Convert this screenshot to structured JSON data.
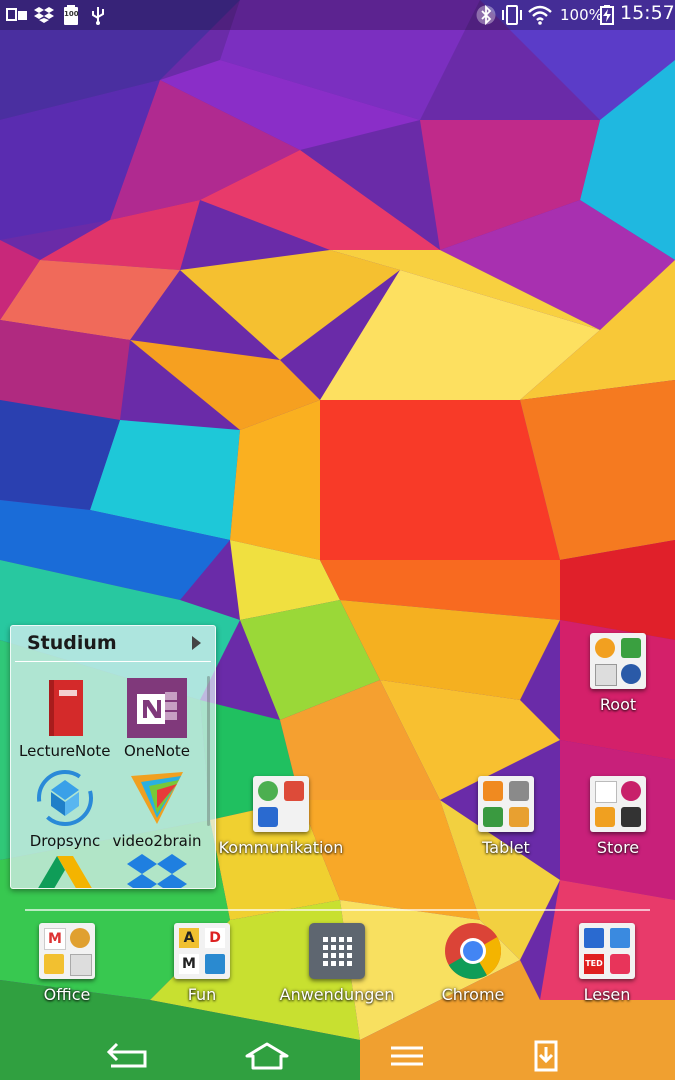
{
  "status_bar": {
    "left_icons": [
      "screen-mirror-icon",
      "dropbox-icon",
      "battery-100-icon",
      "usb-icon"
    ],
    "battery_small_label": "100",
    "right_icons": [
      "bluetooth-icon",
      "vibrate-icon",
      "wifi-icon",
      "battery-charging-icon"
    ],
    "battery_percent": "100%",
    "time": "15:57"
  },
  "folder": {
    "title": "Studium",
    "apps": [
      {
        "label": "LectureNotes",
        "icon": "lecturenotes-icon"
      },
      {
        "label": "OneNote",
        "icon": "onenote-icon"
      },
      {
        "label": "Dropsync",
        "icon": "dropsync-icon"
      },
      {
        "label": "video2brain",
        "icon": "video2brain-icon"
      },
      {
        "label": "",
        "icon": "google-drive-icon"
      },
      {
        "label": "",
        "icon": "dropbox-app-icon"
      }
    ]
  },
  "home_apps": [
    {
      "label": "Root",
      "icon": "root-folder-icon"
    },
    {
      "label": "Kommunikation",
      "icon": "kommunikation-folder-icon"
    },
    {
      "label": "Tablet",
      "icon": "tablet-folder-icon"
    },
    {
      "label": "Store",
      "icon": "store-folder-icon"
    }
  ],
  "dock": [
    {
      "label": "Office",
      "icon": "office-folder-icon"
    },
    {
      "label": "Fun",
      "icon": "fun-folder-icon"
    },
    {
      "label": "Anwendungen",
      "icon": "app-drawer-icon"
    },
    {
      "label": "Chrome",
      "icon": "chrome-icon"
    },
    {
      "label": "Lesen",
      "icon": "lesen-folder-icon"
    }
  ],
  "nav": [
    "back-icon",
    "home-icon",
    "menu-icon",
    "download-tray-icon"
  ],
  "colors": {
    "onenote": "#80397b",
    "lecturenotes": "#d42a2a",
    "chrome_red": "#db4437",
    "chrome_green": "#0f9d58",
    "chrome_yellow": "#f4b400",
    "chrome_blue": "#4285f4"
  }
}
